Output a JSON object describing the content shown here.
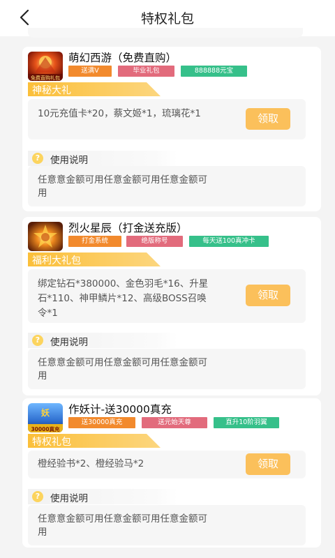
{
  "header": {
    "title": "特权礼包"
  },
  "games": [
    {
      "name": "萌幻西游（免费直购）",
      "icon": "game-icon-fantasy",
      "tags": [
        {
          "text": "送满V",
          "color": "#f28a2d"
        },
        {
          "text": "毕业礼包",
          "color": "#e26b7c"
        },
        {
          "text": "888888元宝",
          "color": "#36c08a"
        }
      ],
      "gift_title": "神秘大礼",
      "gift_content": "10元充值卡*20，蔡文姬*1，琉璃花*1",
      "claim_label": "领取",
      "usage_title": "使用说明",
      "usage_text": "任意意金额可用任意金额可用任意金额可用"
    },
    {
      "name": "烈火星辰（打金送充版）",
      "icon": "game-icon-fire",
      "tags": [
        {
          "text": "打金系统",
          "color": "#f28a2d"
        },
        {
          "text": "绝版称号",
          "color": "#e26b7c"
        },
        {
          "text": "每天送100真冲卡",
          "color": "#36c08a"
        }
      ],
      "gift_title": "福利大礼包",
      "gift_content": "绑定钻石*380000、金色羽毛*16、升星石*110、神甲鳞片*12、高级BOSS召唤令*1",
      "claim_label": "领取",
      "usage_title": "使用说明",
      "usage_text": "任意意金额可用任意金额可用任意金额可用"
    },
    {
      "name": "作妖计-送30000真充",
      "icon": "game-icon-monster",
      "tags": [
        {
          "text": "送30000真充",
          "color": "#f28a2d"
        },
        {
          "text": "送元始天尊",
          "color": "#e26b7c"
        },
        {
          "text": "直升10阶羽翼",
          "color": "#36c08a"
        }
      ],
      "gift_title": "特权礼包",
      "gift_content": "橙经验书*2、橙经验马*2",
      "claim_label": "领取",
      "usage_title": "使用说明",
      "usage_text": "任意意金额可用任意金额可用任意金额可用"
    }
  ],
  "icon_texts": {
    "game1_badge": "免费直购礼包",
    "game3_badge": "30000真充"
  }
}
